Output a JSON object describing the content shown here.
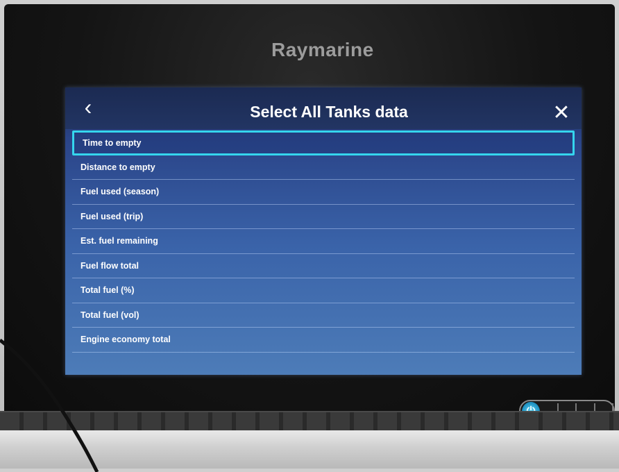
{
  "device": {
    "brand": "Raymarine"
  },
  "dialog": {
    "title": "Select All Tanks data",
    "back_icon": "chevron-left-icon",
    "close_icon": "close-icon",
    "items": [
      {
        "label": "Time to empty",
        "selected": true
      },
      {
        "label": "Distance to empty",
        "selected": false
      },
      {
        "label": "Fuel used (season)",
        "selected": false
      },
      {
        "label": "Fuel used (trip)",
        "selected": false
      },
      {
        "label": "Est. fuel remaining",
        "selected": false
      },
      {
        "label": "Fuel flow total",
        "selected": false
      },
      {
        "label": "Total fuel (%)",
        "selected": false
      },
      {
        "label": "Total fuel (vol)",
        "selected": false
      },
      {
        "label": "Engine economy total",
        "selected": false
      }
    ]
  },
  "colors": {
    "highlight": "#35d6ee",
    "power_button": "#1d8fbf"
  },
  "hardware": {
    "power_icon": "power-icon"
  }
}
